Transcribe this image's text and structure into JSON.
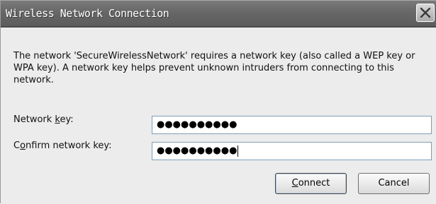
{
  "window": {
    "title": "Wireless Network Connection"
  },
  "message": "The network 'SecureWirelessNetwork' requires a network key (also called a WEP key or WPA key). A network key helps prevent unknown intruders from connecting to this network.",
  "fields": {
    "network_key": {
      "label_pre": "Network ",
      "label_accel": "k",
      "label_post": "ey:",
      "value": "●●●●●●●●●●"
    },
    "confirm_key": {
      "label_pre": "C",
      "label_accel": "o",
      "label_post": "nfirm network key:",
      "value": "●●●●●●●●●●"
    }
  },
  "buttons": {
    "connect_accel": "C",
    "connect_rest": "onnect",
    "cancel": "Cancel"
  },
  "icons": {
    "close": "close-icon"
  }
}
